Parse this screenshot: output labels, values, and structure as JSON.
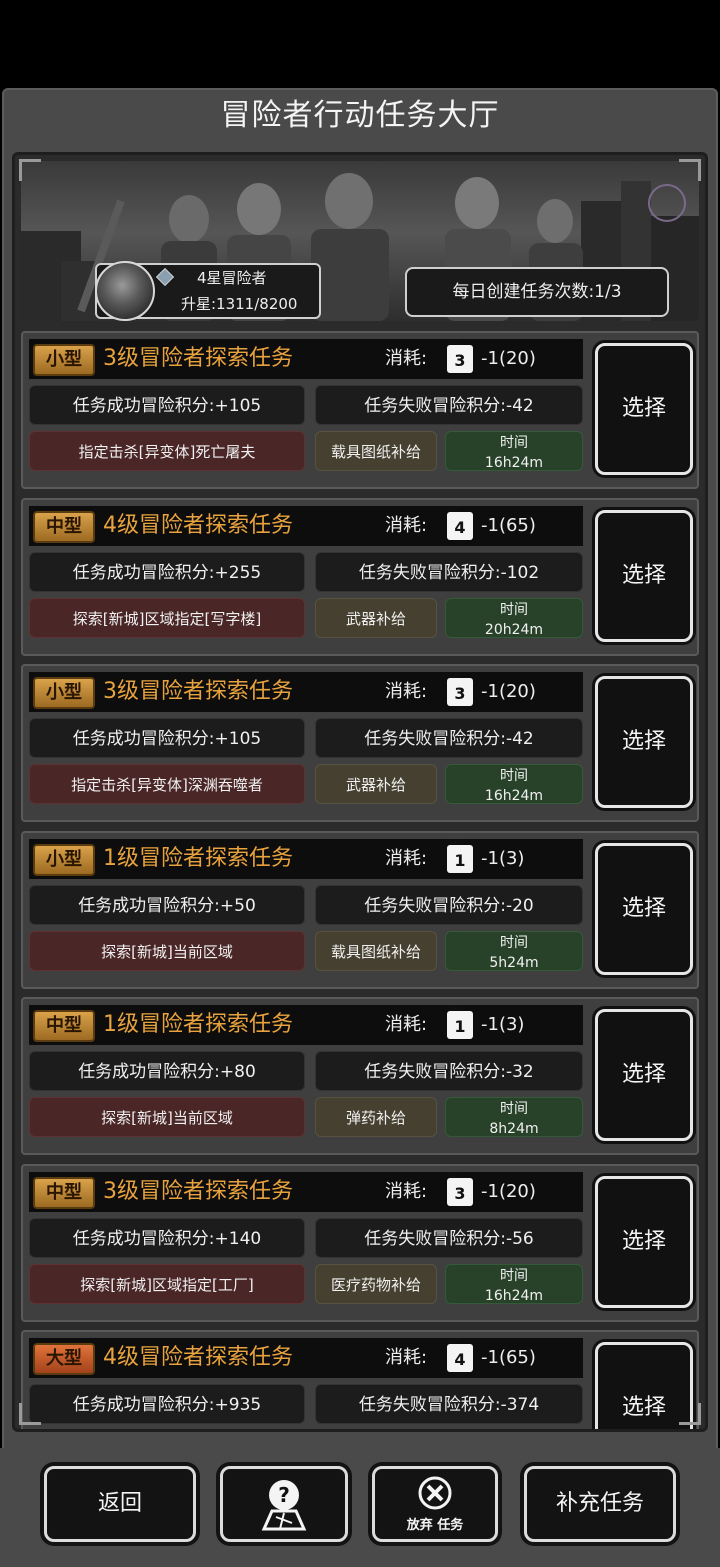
{
  "header": {
    "title": "冒险者行动任务大厅"
  },
  "rank": {
    "title": "4星冒险者",
    "progress": "升星:1311/8200",
    "avatar_icon": "portrait-avatar",
    "badge_icon": "gem-icon"
  },
  "daily": {
    "label": "每日创建任务次数:1/3"
  },
  "cost_label": "消耗:",
  "select_label": "选择",
  "tasks": [
    {
      "size": "小型",
      "size_variant": "normal",
      "name": "3级冒险者探索任务",
      "lv": "3",
      "cost": "-1(20)",
      "success": "任务成功冒险积分:+105",
      "fail": "任务失败冒险积分:-42",
      "objective": "指定击杀[异变体]死亡屠夫",
      "reward": "载具图纸补给",
      "time_label": "时间",
      "time": "16h24m"
    },
    {
      "size": "中型",
      "size_variant": "normal",
      "name": "4级冒险者探索任务",
      "lv": "4",
      "cost": "-1(65)",
      "success": "任务成功冒险积分:+255",
      "fail": "任务失败冒险积分:-102",
      "objective": "探索[新城]区域指定[写字楼]",
      "reward": "武器补给",
      "time_label": "时间",
      "time": "20h24m"
    },
    {
      "size": "小型",
      "size_variant": "normal",
      "name": "3级冒险者探索任务",
      "lv": "3",
      "cost": "-1(20)",
      "success": "任务成功冒险积分:+105",
      "fail": "任务失败冒险积分:-42",
      "objective": "指定击杀[异变体]深渊吞噬者",
      "reward": "武器补给",
      "time_label": "时间",
      "time": "16h24m"
    },
    {
      "size": "小型",
      "size_variant": "normal",
      "name": "1级冒险者探索任务",
      "lv": "1",
      "cost": "-1(3)",
      "success": "任务成功冒险积分:+50",
      "fail": "任务失败冒险积分:-20",
      "objective": "探索[新城]当前区域",
      "reward": "载具图纸补给",
      "time_label": "时间",
      "time": "5h24m"
    },
    {
      "size": "中型",
      "size_variant": "normal",
      "name": "1级冒险者探索任务",
      "lv": "1",
      "cost": "-1(3)",
      "success": "任务成功冒险积分:+80",
      "fail": "任务失败冒险积分:-32",
      "objective": "探索[新城]当前区域",
      "reward": "弹药补给",
      "time_label": "时间",
      "time": "8h24m"
    },
    {
      "size": "中型",
      "size_variant": "normal",
      "name": "3级冒险者探索任务",
      "lv": "3",
      "cost": "-1(20)",
      "success": "任务成功冒险积分:+140",
      "fail": "任务失败冒险积分:-56",
      "objective": "探索[新城]区域指定[工厂]",
      "reward": "医疗药物补给",
      "time_label": "时间",
      "time": "16h24m"
    },
    {
      "size": "大型",
      "size_variant": "big",
      "name": "4级冒险者探索任务",
      "lv": "4",
      "cost": "-1(65)",
      "success": "任务成功冒险积分:+935",
      "fail": "任务失败冒险积分:-374",
      "objective": "",
      "reward": "",
      "time_label": "",
      "time": ""
    }
  ],
  "bottom": {
    "back": "返回",
    "help_icon": "help-map-icon",
    "abandon_icon": "close-circle-icon",
    "abandon": "放弃 任务",
    "refill": "补充任务"
  }
}
